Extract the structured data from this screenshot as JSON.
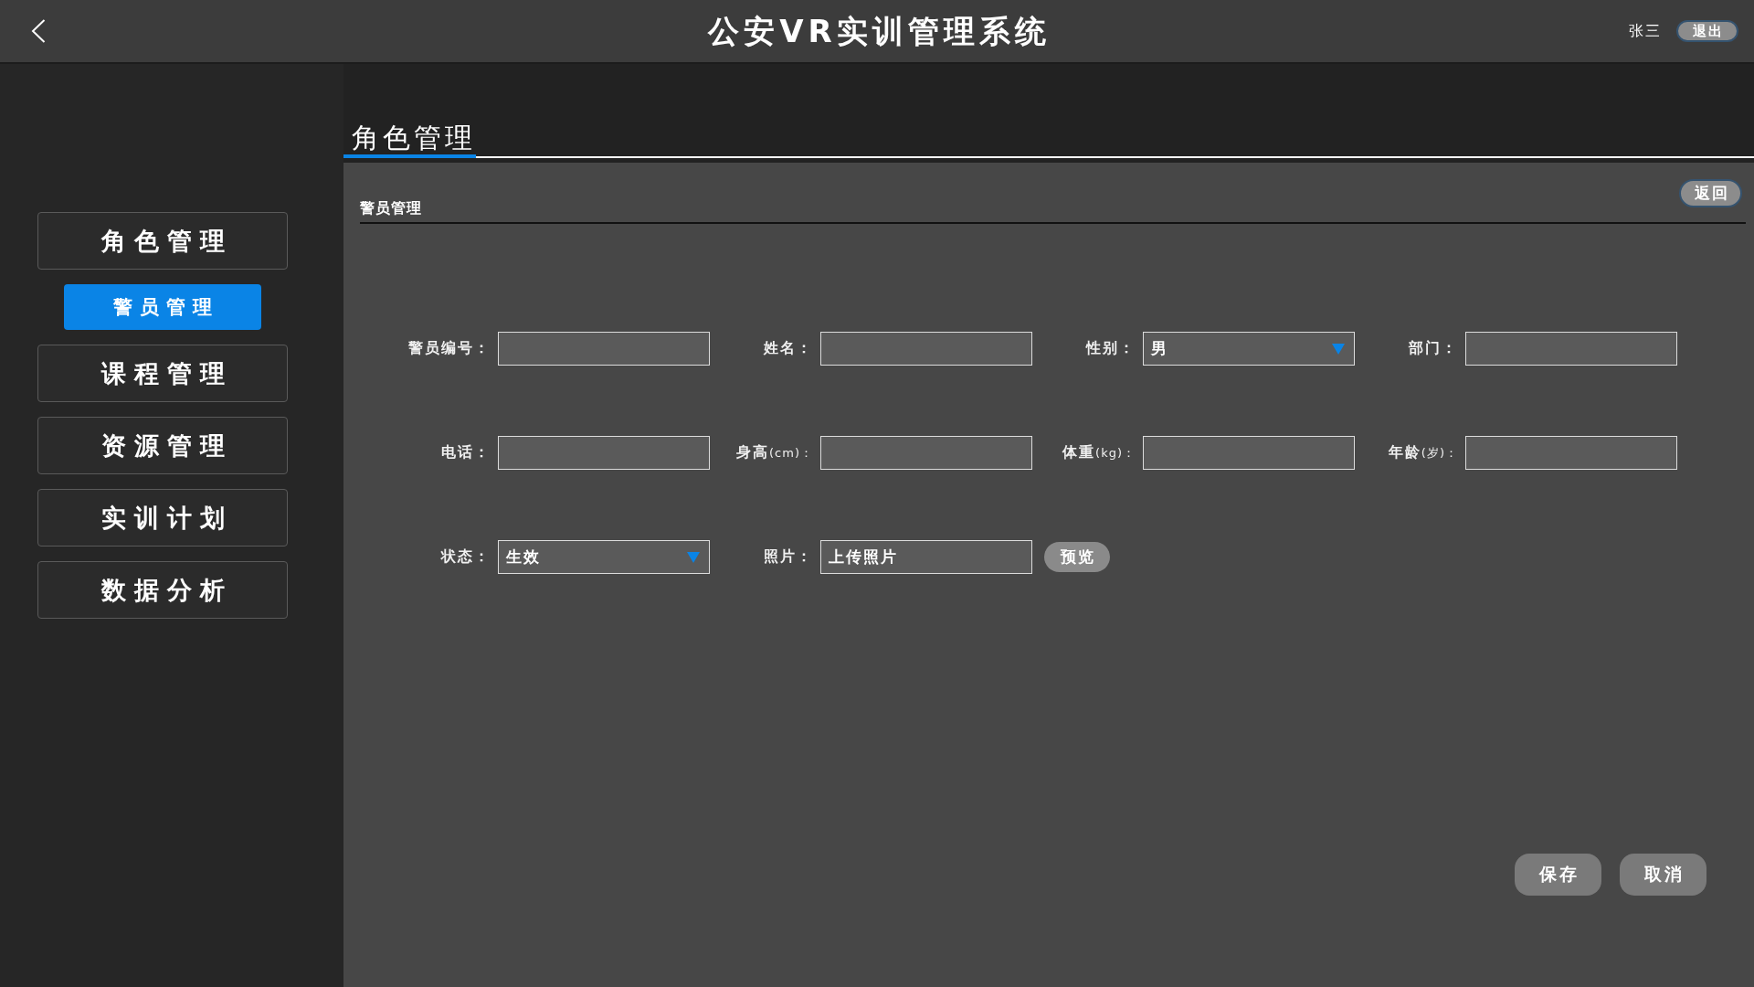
{
  "header": {
    "title": "公安VR实训管理系统",
    "user": "张三",
    "logout": "退出"
  },
  "sidebar": {
    "items": [
      {
        "label": "角色管理",
        "selected": false,
        "children": [
          {
            "label": "警员管理",
            "selected": true
          }
        ]
      },
      {
        "label": "课程管理",
        "selected": false
      },
      {
        "label": "资源管理",
        "selected": false
      },
      {
        "label": "实训计划",
        "selected": false
      },
      {
        "label": "数据分析",
        "selected": false
      }
    ]
  },
  "tabs": [
    {
      "label": "角色管理",
      "selected": true
    }
  ],
  "panel": {
    "title": "警员管理",
    "back_button": "返回"
  },
  "form": {
    "fields": [
      {
        "label": "警员编号：",
        "kind": "text"
      },
      {
        "label": "姓名：",
        "kind": "text"
      },
      {
        "label": "性别：",
        "kind": "select",
        "value": "男"
      },
      {
        "label": "部门：",
        "kind": "text"
      },
      {
        "label": "电话：",
        "kind": "text"
      },
      {
        "label": "身高",
        "unit": "(cm)：",
        "kind": "text"
      },
      {
        "label": "体重",
        "unit": "(kg)：",
        "kind": "text"
      },
      {
        "label": "年龄",
        "unit": "(岁)：",
        "kind": "text"
      },
      {
        "label": "状态：",
        "kind": "select",
        "value": "生效"
      },
      {
        "label": "照片：",
        "kind": "upload",
        "value": "上传照片",
        "button": "预览"
      }
    ]
  },
  "actions": [
    "保存",
    "取消"
  ]
}
